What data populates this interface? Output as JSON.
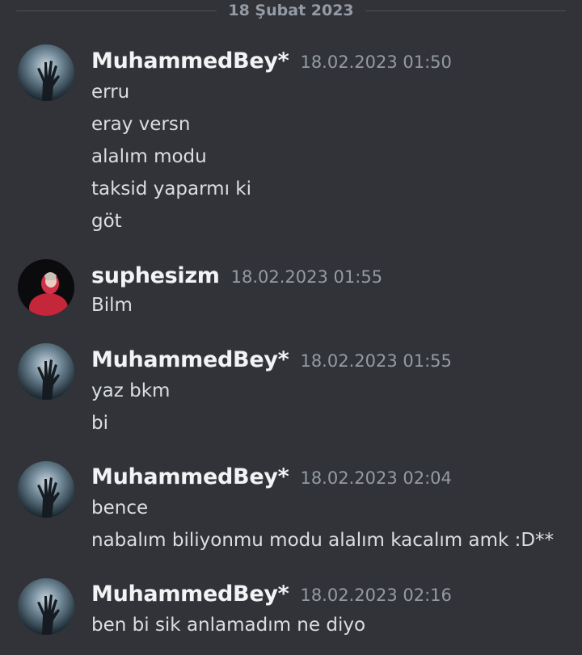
{
  "divider": {
    "date": "18 Şubat 2023"
  },
  "messages": [
    {
      "author": "MuhammedBey*",
      "timestamp": "18.02.2023 01:50",
      "avatar": "zombie-hand-moon-avatar",
      "lines": [
        "erru",
        "eray versn",
        "alalım modu",
        "taksid yaparmı ki",
        "göt"
      ]
    },
    {
      "author": "suphesizm",
      "timestamp": "18.02.2023 01:55",
      "avatar": "red-hoodie-avatar",
      "lines": [
        "Bilm"
      ]
    },
    {
      "author": "MuhammedBey*",
      "timestamp": "18.02.2023 01:55",
      "avatar": "zombie-hand-moon-avatar",
      "lines": [
        "yaz bkm",
        "bi"
      ]
    },
    {
      "author": "MuhammedBey*",
      "timestamp": "18.02.2023 02:04",
      "avatar": "zombie-hand-moon-avatar",
      "lines": [
        "bence",
        "nabalım biliyonmu modu alalım kacalım amk :D**"
      ]
    },
    {
      "author": "MuhammedBey*",
      "timestamp": "18.02.2023 02:16",
      "avatar": "zombie-hand-moon-avatar",
      "lines": [
        "ben bi sik anlamadım ne diyo"
      ]
    }
  ],
  "colors": {
    "background": "#313338",
    "username": "#f2f3f5",
    "text": "#dbdee1",
    "muted": "#949ba4"
  }
}
